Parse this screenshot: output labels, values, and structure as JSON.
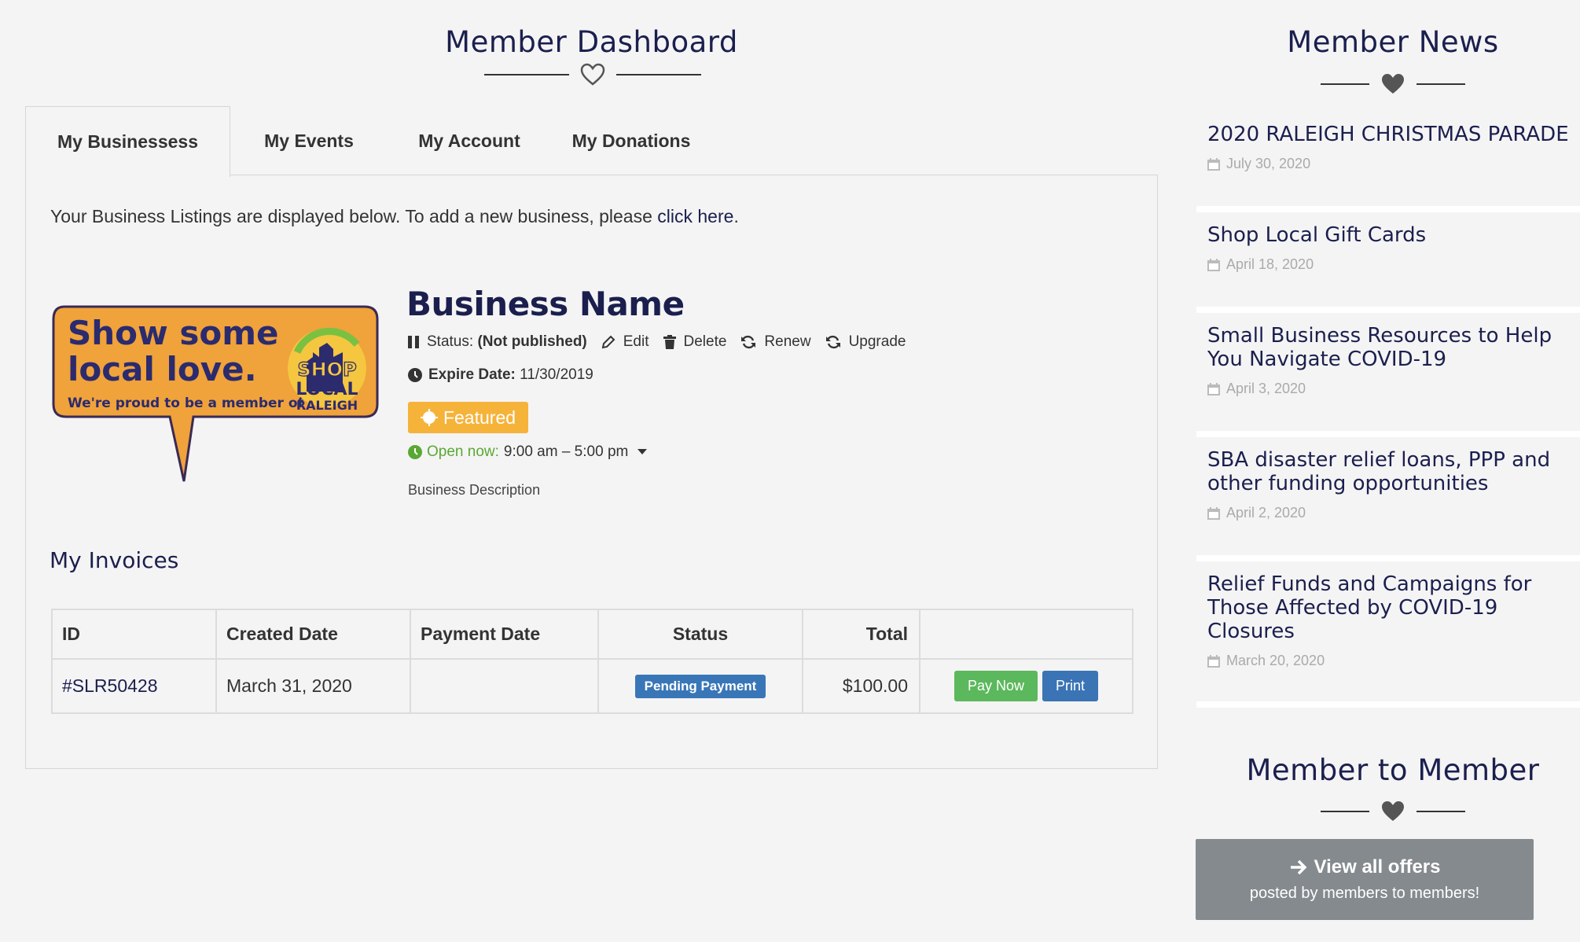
{
  "dashboard": {
    "title": "Member Dashboard"
  },
  "tabs": [
    {
      "label": "My Businessess"
    },
    {
      "label": "My Events"
    },
    {
      "label": "My Account"
    },
    {
      "label": "My Donations"
    }
  ],
  "intro": {
    "text": "Your Business Listings are displayed below. To add a new business, please ",
    "link": "click here",
    "end": "."
  },
  "logo": {
    "line1": "Show some",
    "line2": "local love.",
    "line3": "We're proud to be a member of",
    "badge1": "SHOP",
    "badge2": "LOCAL",
    "badge3": "RALEIGH"
  },
  "business": {
    "name": "Business Name",
    "status_label": "Status:",
    "status_value": "(Not published)",
    "edit": "Edit",
    "delete": "Delete",
    "renew": "Renew",
    "upgrade": "Upgrade",
    "expire_label": "Expire Date:",
    "expire_value": "11/30/2019",
    "featured": "Featured",
    "open_label": "Open now:",
    "hours": "9:00 am – 5:00 pm",
    "description": "Business Description"
  },
  "invoices": {
    "title": "My Invoices",
    "headers": {
      "id": "ID",
      "created": "Created Date",
      "payment": "Payment Date",
      "status": "Status",
      "total": "Total"
    },
    "rows": [
      {
        "id": "#SLR50428",
        "created": "March 31, 2020",
        "payment": "",
        "status": "Pending Payment",
        "total": "$100.00",
        "pay": "Pay Now",
        "print": "Print"
      }
    ]
  },
  "news": {
    "title": "Member News",
    "items": [
      {
        "title": "2020 RALEIGH CHRISTMAS PARADE",
        "date": "July 30, 2020"
      },
      {
        "title": "Shop Local Gift Cards",
        "date": "April 18, 2020"
      },
      {
        "title": "Small Business Resources to Help You Navigate COVID-19",
        "date": "April 3, 2020"
      },
      {
        "title": "SBA disaster relief loans, PPP and other funding opportunities",
        "date": "April 2, 2020"
      },
      {
        "title": "Relief Funds and Campaigns for Those Affected by COVID-19 Closures",
        "date": "March 20, 2020"
      }
    ]
  },
  "m2m": {
    "title": "Member to Member",
    "button_line1": "View all offers",
    "button_line2": "posted by members to members!"
  },
  "colors": {
    "navy": "#1b1f4e",
    "featured": "#f6b33a",
    "green": "#5cb85c",
    "blue": "#3a74b5",
    "open": "#5aa834"
  },
  "icons": [
    "heart-outline-icon",
    "heart-icon",
    "pause-icon",
    "pencil-icon",
    "trash-icon",
    "refresh-icon",
    "clock-icon",
    "sun-icon",
    "chevron-down-icon",
    "calendar-icon",
    "arrow-right-icon"
  ]
}
